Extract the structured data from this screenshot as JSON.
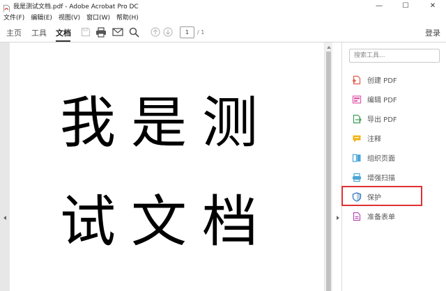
{
  "window": {
    "title": "我是测试文档.pdf - Adobe Acrobat Pro DC",
    "minimize": "—",
    "maximize": "☐",
    "close": "✕"
  },
  "menu": [
    "文件(F)",
    "编辑(E)",
    "视图(V)",
    "窗口(W)",
    "帮助(H)"
  ],
  "toolbar": {
    "tabs": [
      "主页",
      "工具",
      "文档"
    ],
    "active_tab": "文档",
    "page_current": "1",
    "page_total": "/ 1",
    "login": "登录"
  },
  "document": {
    "lines": [
      "我是测",
      "试文档"
    ]
  },
  "right_panel": {
    "search_placeholder": "搜索工具...",
    "tools": [
      {
        "label": "创建 PDF",
        "icon": "create-pdf-icon",
        "color": "#e35b4b"
      },
      {
        "label": "编辑 PDF",
        "icon": "edit-pdf-icon",
        "color": "#e05aa9"
      },
      {
        "label": "导出 PDF",
        "icon": "export-pdf-icon",
        "color": "#3f9d55"
      },
      {
        "label": "注释",
        "icon": "comment-icon",
        "color": "#f2b418"
      },
      {
        "label": "组织页面",
        "icon": "organize-pages-icon",
        "color": "#4aa6d8"
      },
      {
        "label": "增强扫描",
        "icon": "enhance-scan-icon",
        "color": "#4aa6d8"
      },
      {
        "label": "保护",
        "icon": "protect-icon",
        "color": "#3a7bbf"
      },
      {
        "label": "准备表单",
        "icon": "prepare-form-icon",
        "color": "#b34fb0"
      }
    ],
    "highlight_color": "#e03030"
  }
}
